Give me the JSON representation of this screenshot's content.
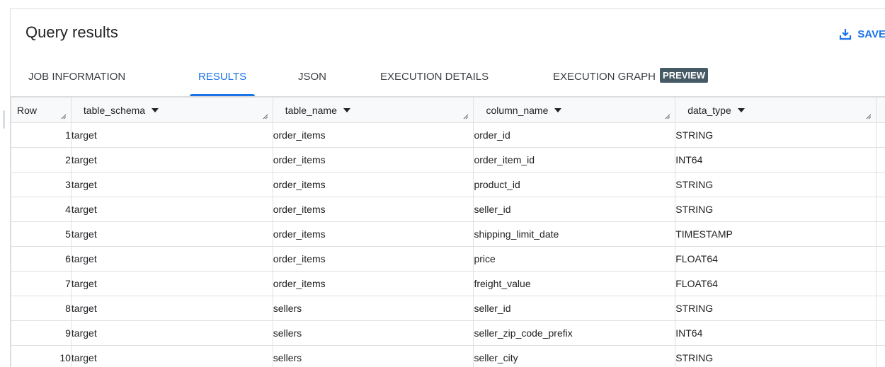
{
  "header": {
    "title": "Query results",
    "save_label": "SAVE"
  },
  "tabs": [
    {
      "label": "JOB INFORMATION",
      "active": false
    },
    {
      "label": "RESULTS",
      "active": true
    },
    {
      "label": "JSON",
      "active": false
    },
    {
      "label": "EXECUTION DETAILS",
      "active": false
    },
    {
      "label": "EXECUTION GRAPH",
      "active": false,
      "badge": "PREVIEW"
    }
  ],
  "table": {
    "columns": [
      "Row",
      "table_schema",
      "table_name",
      "column_name",
      "data_type"
    ],
    "rows": [
      [
        "1",
        "target",
        "order_items",
        "order_id",
        "STRING"
      ],
      [
        "2",
        "target",
        "order_items",
        "order_item_id",
        "INT64"
      ],
      [
        "3",
        "target",
        "order_items",
        "product_id",
        "STRING"
      ],
      [
        "4",
        "target",
        "order_items",
        "seller_id",
        "STRING"
      ],
      [
        "5",
        "target",
        "order_items",
        "shipping_limit_date",
        "TIMESTAMP"
      ],
      [
        "6",
        "target",
        "order_items",
        "price",
        "FLOAT64"
      ],
      [
        "7",
        "target",
        "order_items",
        "freight_value",
        "FLOAT64"
      ],
      [
        "8",
        "target",
        "sellers",
        "seller_id",
        "STRING"
      ],
      [
        "9",
        "target",
        "sellers",
        "seller_zip_code_prefix",
        "INT64"
      ],
      [
        "10",
        "target",
        "sellers",
        "seller_city",
        "STRING"
      ]
    ]
  },
  "icons": {
    "save": "download-icon",
    "sort": "sort-desc-icon",
    "resize": "resize-grip-icon"
  },
  "colors": {
    "accent": "#1a73e8",
    "badge": "#455a64"
  }
}
